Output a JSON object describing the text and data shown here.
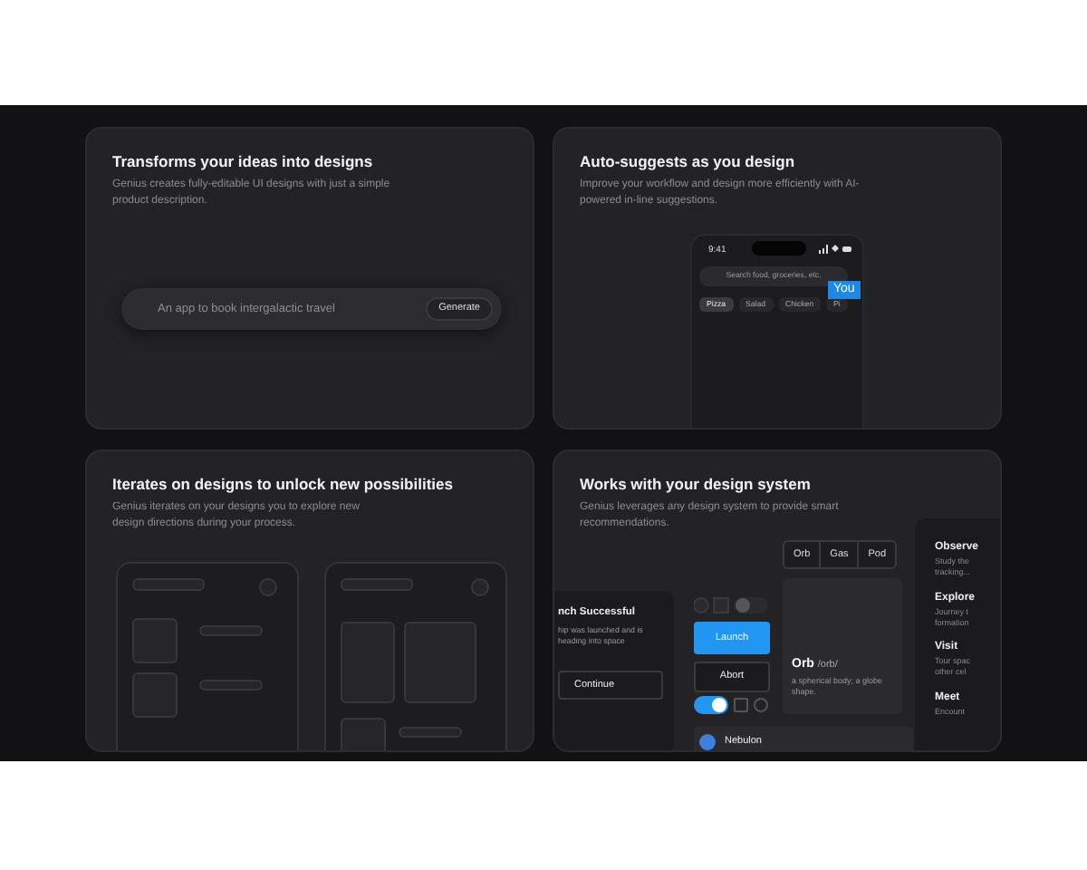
{
  "cards": [
    {
      "kind": "prompt",
      "title": "Transforms your ideas into designs",
      "description": "Genius creates fully-editable UI designs with just a simple product description.",
      "prompt": {
        "placeholder": "An app to book intergalactic travel",
        "button": "Generate"
      }
    },
    {
      "kind": "phone",
      "title": "Auto-suggests as you design",
      "description": "Improve your workflow and design more efficiently with AI-powered in-line suggestions.",
      "phone": {
        "time": "9:41",
        "search_placeholder": "Search food, groceries, etc.",
        "cursor_label": "You",
        "chips": [
          {
            "label": "Pizza",
            "selected": true
          },
          {
            "label": "Salad",
            "selected": false
          },
          {
            "label": "Chicken",
            "selected": false
          },
          {
            "label": "Pi",
            "selected": false
          }
        ]
      }
    },
    {
      "kind": "wireframes",
      "title": "Iterates on designs to unlock new possibilities",
      "description": "Genius iterates on your designs you to explore new design directions during your process."
    },
    {
      "kind": "design_system",
      "title": "Works with your design system",
      "description": "Genius leverages any design system to provide smart recommendations.",
      "segments": [
        {
          "label": "Orb"
        },
        {
          "label": "Gas"
        },
        {
          "label": "Pod"
        }
      ],
      "notification": {
        "title": "nch Successful",
        "body": "hip was launched and is heading into space",
        "button": "Continue"
      },
      "buttons": [
        {
          "label": "Launch",
          "kind": "primary"
        },
        {
          "label": "Abort",
          "kind": "outline"
        }
      ],
      "toggle": {
        "on": true
      },
      "checkbox": {
        "checked": false
      },
      "radio": {
        "selected": false
      },
      "dictionary": {
        "word": "Orb",
        "pronunciation": "/orb/",
        "definition": "a spherical body; a globe shape."
      },
      "list_item": "Nebulon",
      "menu": [
        {
          "title": "Observe",
          "lines": [
            "Study the",
            "tracking..."
          ]
        },
        {
          "title": "Explore",
          "lines": [
            "Journey t",
            "formation"
          ]
        },
        {
          "title": "Visit",
          "lines": [
            "Tour spac",
            "other cel"
          ]
        },
        {
          "title": "Meet",
          "lines": [
            "Encount"
          ]
        }
      ]
    }
  ]
}
